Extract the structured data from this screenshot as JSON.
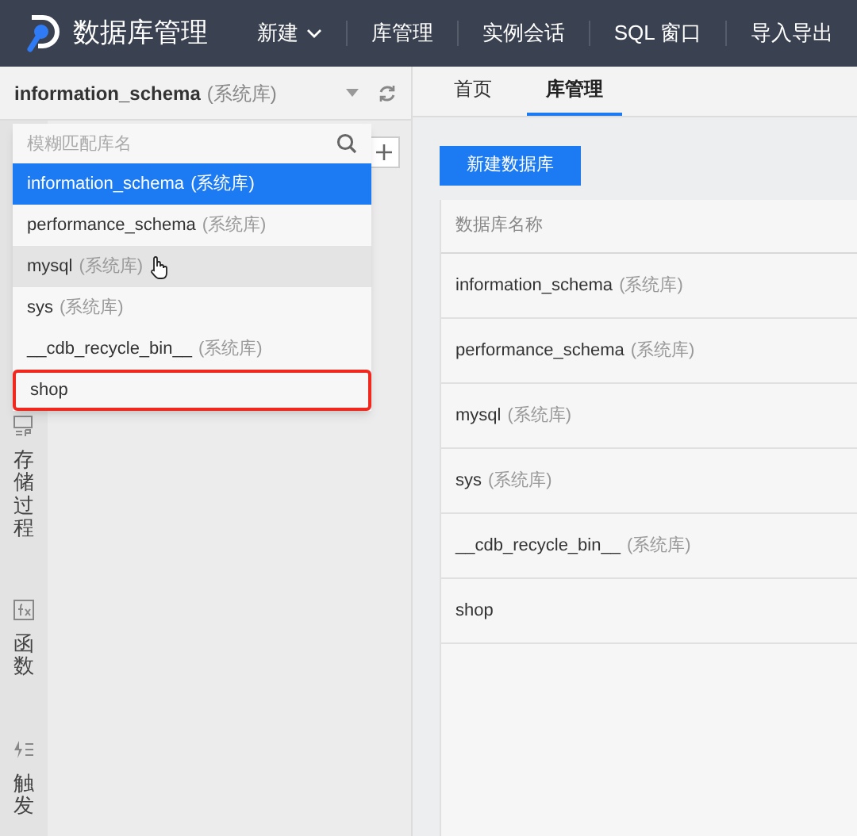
{
  "app": {
    "title": "数据库管理"
  },
  "nav": [
    {
      "label": "新建",
      "kind": "dropdown"
    },
    {
      "label": "库管理",
      "kind": "link"
    },
    {
      "label": "实例会话",
      "kind": "link"
    },
    {
      "label": "SQL 窗口",
      "kind": "link"
    },
    {
      "label": "导入导出",
      "kind": "link"
    }
  ],
  "db_selector": {
    "name": "information_schema",
    "tag": "(系统库)"
  },
  "dropdown": {
    "placeholder": "模糊匹配库名",
    "items": [
      {
        "name": "information_schema",
        "tag": "(系统库)",
        "selected": true,
        "hovered": false,
        "highlighted": false
      },
      {
        "name": "performance_schema",
        "tag": "(系统库)",
        "selected": false,
        "hovered": false,
        "highlighted": false
      },
      {
        "name": "mysql",
        "tag": "(系统库)",
        "selected": false,
        "hovered": true,
        "highlighted": false
      },
      {
        "name": "sys",
        "tag": "(系统库)",
        "selected": false,
        "hovered": false,
        "highlighted": false
      },
      {
        "name": "__cdb_recycle_bin__",
        "tag": "(系统库)",
        "selected": false,
        "hovered": false,
        "highlighted": false
      },
      {
        "name": "shop",
        "selected": false,
        "hovered": false,
        "highlighted": true
      }
    ]
  },
  "side_tools": [
    {
      "label": "存储过程",
      "kind": "procedure"
    },
    {
      "label": "函数",
      "kind": "function"
    },
    {
      "label": "触发",
      "kind": "trigger"
    }
  ],
  "tabs": [
    {
      "label": "首页",
      "selected": false
    },
    {
      "label": "库管理",
      "selected": true
    }
  ],
  "create_button": "新建数据库",
  "table": {
    "columns": [
      "数据库名称"
    ],
    "rows": [
      {
        "name": "information_schema",
        "tag": "(系统库)"
      },
      {
        "name": "performance_schema",
        "tag": "(系统库)"
      },
      {
        "name": "mysql",
        "tag": "(系统库)"
      },
      {
        "name": "sys",
        "tag": "(系统库)"
      },
      {
        "name": "__cdb_recycle_bin__",
        "tag": "(系统库)"
      },
      {
        "name": "shop"
      }
    ]
  }
}
